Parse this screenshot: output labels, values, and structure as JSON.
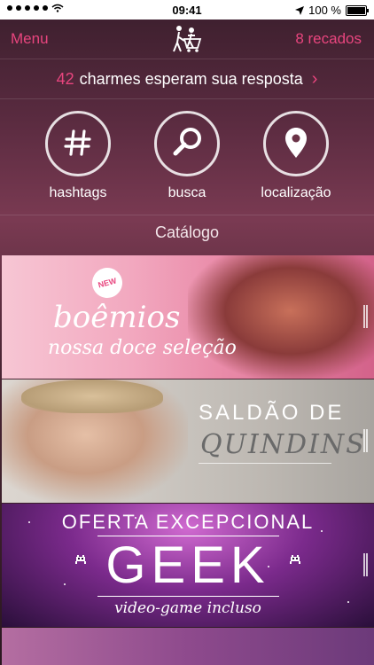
{
  "status_bar": {
    "time": "09:41",
    "battery": "100 %"
  },
  "nav": {
    "left": "Menu",
    "right": "8 recados",
    "logo_icon": "couple-logo-icon"
  },
  "charmes": {
    "count": "42",
    "text": "charmes esperam sua resposta"
  },
  "actions": [
    {
      "label": "hashtags",
      "icon": "hashtag-icon"
    },
    {
      "label": "busca",
      "icon": "magnifier-icon"
    },
    {
      "label": "localização",
      "icon": "location-pin-icon"
    }
  ],
  "catalog_title": "Catálogo",
  "banners": {
    "b1": {
      "badge": "NEW",
      "title": "boêmios",
      "subtitle": "nossa doce seleção"
    },
    "b2": {
      "line1": "SALDÃO DE",
      "line2": "QUINDINS"
    },
    "b3": {
      "top": "OFERTA EXCEPCIONAL",
      "main": "GEEK",
      "sub": "video-game incluso"
    }
  },
  "colors": {
    "accent": "#e8457e"
  }
}
